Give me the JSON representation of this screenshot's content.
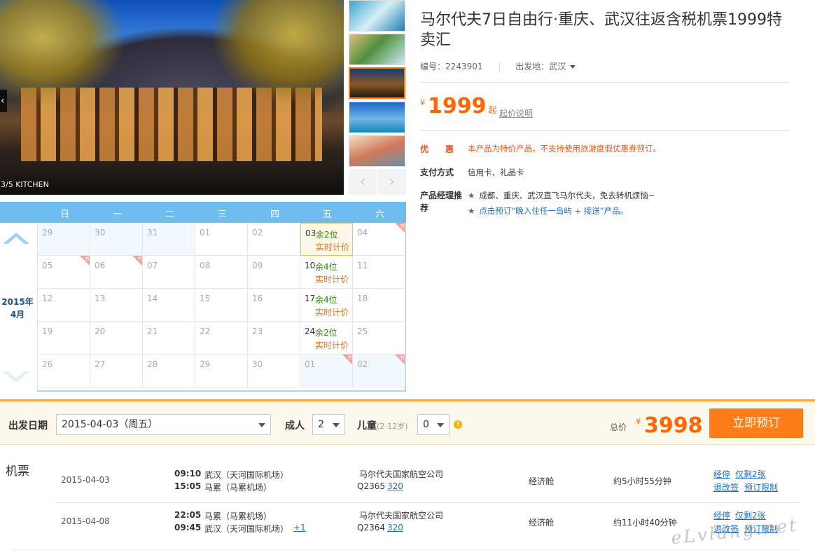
{
  "gallery": {
    "caption": "3/5 KITCHEN",
    "prev_icon": "chevron-left-icon",
    "thumb_nav": {
      "up_icon": "chevron-left-icon",
      "down_icon": "chevron-right-icon"
    }
  },
  "product": {
    "title": "马尔代夫7日自由行·重庆、武汉往返含税机票1999特卖汇",
    "code_label": "编号：",
    "code": "2243901",
    "departure_label": "出发地：",
    "departure": "武汉",
    "price_currency": "¥",
    "price": "1999",
    "price_suffix": "起",
    "price_desc_link": "起价说明",
    "promo_label": "优　　惠",
    "promo_text": "本产品为特价产品，不支持使用旅游度假优惠券预订。",
    "payment_label": "支付方式",
    "payment_text": "信用卡、礼品卡",
    "manager_label": "产品经理推荐",
    "recommend_1": "成都、重庆、武汉直飞马尔代夫，免去转机烦恼~",
    "recommend_2": "点击预订“晚入住任一岛屿 + 接送”产品。"
  },
  "calendar": {
    "month_label_year": "2015年",
    "month_label_month": "4月",
    "weekdays": [
      "日",
      "一",
      "二",
      "三",
      "四",
      "五",
      "六"
    ],
    "weeks": [
      [
        {
          "d": "29",
          "other": true
        },
        {
          "d": "30",
          "other": true
        },
        {
          "d": "31",
          "other": true
        },
        {
          "d": "01"
        },
        {
          "d": "02"
        },
        {
          "d": "03",
          "seats": "余2位",
          "price": "实时计价",
          "sel": true
        },
        {
          "d": "04",
          "holiday": true
        }
      ],
      [
        {
          "d": "05",
          "holiday": true
        },
        {
          "d": "06",
          "holiday": true
        },
        {
          "d": "07"
        },
        {
          "d": "08"
        },
        {
          "d": "09"
        },
        {
          "d": "10",
          "seats": "余4位",
          "price": "实时计价"
        },
        {
          "d": "11"
        }
      ],
      [
        {
          "d": "12"
        },
        {
          "d": "13"
        },
        {
          "d": "14"
        },
        {
          "d": "15"
        },
        {
          "d": "16"
        },
        {
          "d": "17",
          "seats": "余4位",
          "price": "实时计价"
        },
        {
          "d": "18"
        }
      ],
      [
        {
          "d": "19"
        },
        {
          "d": "20"
        },
        {
          "d": "21"
        },
        {
          "d": "22"
        },
        {
          "d": "23"
        },
        {
          "d": "24",
          "seats": "余2位",
          "price": "实时计价"
        },
        {
          "d": "25"
        }
      ],
      [
        {
          "d": "26"
        },
        {
          "d": "27"
        },
        {
          "d": "28"
        },
        {
          "d": "29"
        },
        {
          "d": "30"
        },
        {
          "d": "01",
          "other": true,
          "holiday": true
        },
        {
          "d": "02",
          "other": true,
          "holiday": true
        }
      ]
    ],
    "holiday_mark": "节"
  },
  "booking": {
    "date_label": "出发日期",
    "date_value": "2015-04-03（周五）",
    "adult_label": "成人",
    "adult_value": "2",
    "child_label": "儿童",
    "child_hint": "(2-12岁)",
    "child_value": "0",
    "warn_icon": "!",
    "total_label": "总价",
    "total_currency": "¥",
    "total_value": "3998",
    "book_button": "立即预订"
  },
  "flights": {
    "title": "机票",
    "rows": [
      {
        "date": "2015-04-03",
        "dep_time": "09:10",
        "dep_airport": "武汉（天河国际机场）",
        "arr_time": "15:05",
        "arr_airport": "马累（马累机场）",
        "extra": "",
        "airline": "马尔代夫国家航空公司",
        "flight_no": "Q2365",
        "model": "320",
        "cabin": "经济舱",
        "duration": "约5小时55分钟",
        "link_a": "经停",
        "link_b": "仅剩2张",
        "link_c": "退改签",
        "link_d": "预订限制"
      },
      {
        "date": "2015-04-08",
        "dep_time": "22:05",
        "dep_airport": "马累（马累机场）",
        "arr_time": "09:45",
        "arr_airport": "武汉（天河国际机场）",
        "extra": "+1",
        "airline": "马尔代夫国家航空公司",
        "flight_no": "Q2364",
        "model": "320",
        "cabin": "经济舱",
        "duration": "约11小时40分钟",
        "link_a": "经停",
        "link_b": "仅剩2张",
        "link_c": "退改签",
        "link_d": "预订限制"
      }
    ]
  },
  "watermark": "eLvlang.net"
}
